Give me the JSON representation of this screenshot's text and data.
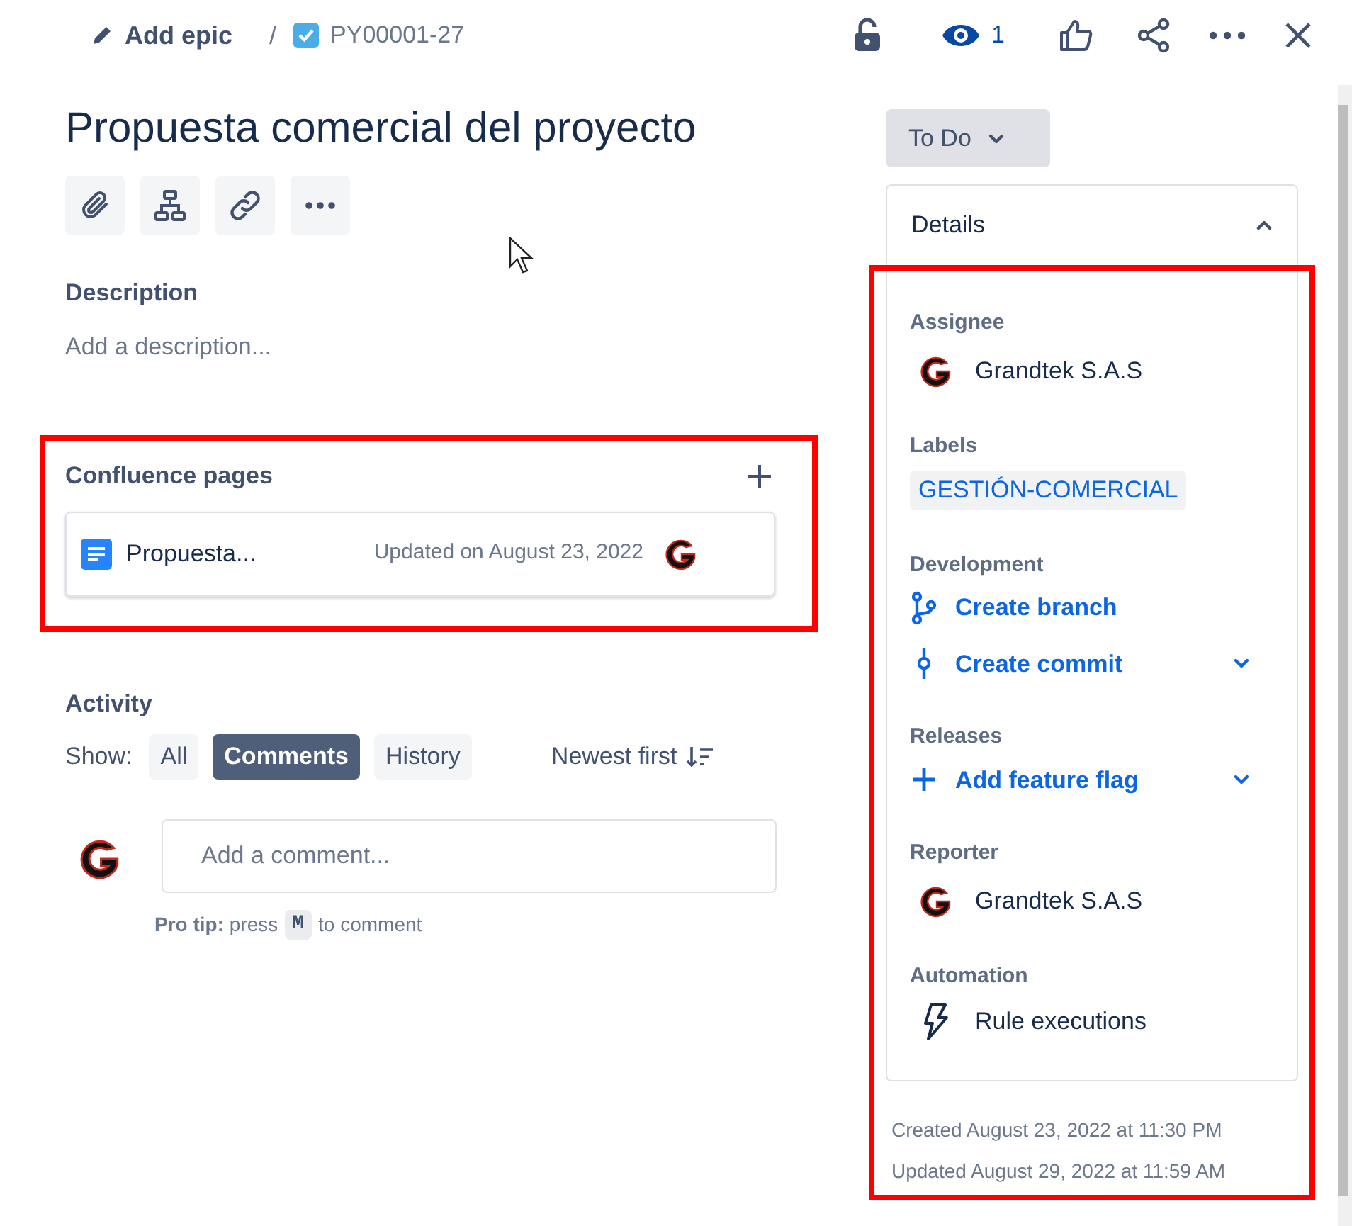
{
  "breadcrumb": {
    "epic": "Add epic",
    "separator": "/",
    "issue_key": "PY00001-27"
  },
  "header": {
    "watchers": "1"
  },
  "title": "Propuesta comercial del proyecto",
  "description": {
    "label": "Description",
    "placeholder": "Add a description..."
  },
  "confluence": {
    "title": "Confluence pages",
    "highlighted": true,
    "pages": [
      {
        "name": "Propuesta...",
        "updated": "Updated on August 23, 2022"
      }
    ]
  },
  "activity": {
    "title": "Activity",
    "show_label": "Show:",
    "filters": [
      {
        "label": "All",
        "selected": false
      },
      {
        "label": "Comments",
        "selected": true
      },
      {
        "label": "History",
        "selected": false
      }
    ],
    "sort": "Newest first",
    "comment_placeholder": "Add a comment...",
    "tip": {
      "prefix": "**Pro tip:** press",
      "key": "M",
      "suffix": "to comment"
    }
  },
  "status": "To Do",
  "details": {
    "title": "Details",
    "expanded": true,
    "highlighted": true,
    "fields": [
      {
        "label": "Assignee",
        "kind": "user",
        "value": "Grandtek S.A.S"
      },
      {
        "label": "Labels",
        "kind": "labels",
        "tags": [
          "GESTIÓN-COMERCIAL"
        ]
      },
      {
        "label": "Development",
        "kind": "actions",
        "actions": [
          {
            "text": "Create branch",
            "kind": "branch",
            "dropdown": false
          },
          {
            "text": "Create commit",
            "kind": "commit",
            "dropdown": true
          }
        ]
      },
      {
        "label": "Releases",
        "kind": "actions",
        "actions": [
          {
            "text": "Add feature flag",
            "kind": "add",
            "dropdown": true
          }
        ]
      },
      {
        "label": "Reporter",
        "kind": "user",
        "value": "Grandtek S.A.S"
      },
      {
        "label": "Automation",
        "kind": "automation",
        "value": "Rule executions"
      }
    ]
  },
  "dates": [
    "Created August 23, 2022 at 11:30 PM",
    "Updated August 29, 2022 at 11:59 AM"
  ]
}
